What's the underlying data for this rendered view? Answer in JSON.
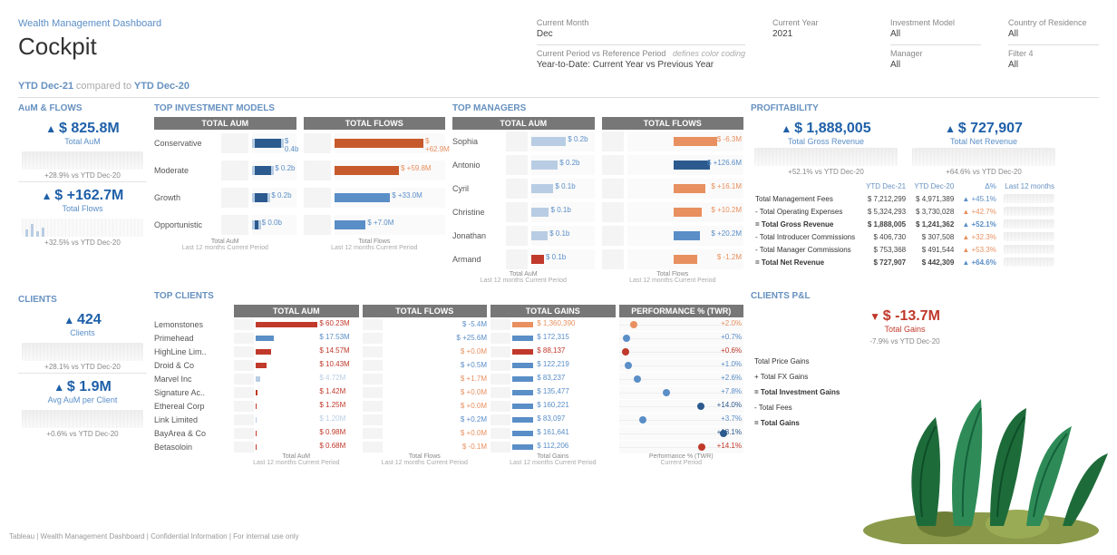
{
  "header": {
    "subtitle": "Wealth Management Dashboard",
    "title": "Cockpit"
  },
  "filters": {
    "current_month_label": "Current Month",
    "current_month": "Dec",
    "current_year_label": "Current Year",
    "current_year": "2021",
    "investment_model_label": "Investment Model",
    "investment_model": "All",
    "country_label": "Country of Residence",
    "country": "All",
    "period_vs_label": "Current Period vs Reference Period",
    "period_note": "defines color coding",
    "period_value": "Year-to-Date: Current Year vs Previous Year",
    "manager_label": "Manager",
    "manager": "All",
    "filter4_label": "Filter 4",
    "filter4": "All"
  },
  "period": {
    "current": "YTD Dec-21",
    "compare_word": "compared to",
    "reference": "YTD Dec-20"
  },
  "aum_flows": {
    "title": "AuM & FLOWS",
    "aum_value": "$ 825.8M",
    "aum_label": "Total AuM",
    "aum_delta": "+28.9% vs YTD Dec-20",
    "flows_value": "$ +162.7M",
    "flows_label": "Total Flows",
    "flows_delta": "+32.5% vs YTD Dec-20"
  },
  "top_models": {
    "title": "TOP INVESTMENT MODELS",
    "col_aum": "TOTAL AUM",
    "col_flows": "TOTAL FLOWS",
    "axis_aum": "Total AuM",
    "axis_flows": "Total Flows",
    "axis_sub1": "Last 12 months",
    "axis_sub2": "Current Period",
    "rows": [
      {
        "name": "Conservative",
        "aum_val": "$ 0.4b",
        "flow_val": "$ +62.9M",
        "flow_color": "dor",
        "aum_w": 60
      },
      {
        "name": "Moderate",
        "aum_val": "$ 0.2b",
        "flow_val": "$ +59.8M",
        "flow_color": "dor",
        "aum_w": 38
      },
      {
        "name": "Growth",
        "aum_val": "$ 0.2b",
        "flow_val": "$ +33.0M",
        "flow_color": "blue",
        "aum_w": 30
      },
      {
        "name": "Opportunistic",
        "aum_val": "$ 0.0b",
        "flow_val": "$ +7.0M",
        "flow_color": "blue",
        "aum_w": 8
      }
    ]
  },
  "top_managers": {
    "title": "TOP MANAGERS",
    "col_aum": "TOTAL AUM",
    "col_flows": "TOTAL FLOWS",
    "rows": [
      {
        "name": "Sophia",
        "aum_val": "$ 0.2b",
        "flow_val": "$ -6.3M",
        "flow_color": "or",
        "aum_w": 55
      },
      {
        "name": "Antonio",
        "aum_val": "$ 0.2b",
        "flow_val": "$ +126.6M",
        "flow_color": "dark",
        "aum_w": 42
      },
      {
        "name": "Cyril",
        "aum_val": "$ 0.1b",
        "flow_val": "$ +16.1M",
        "flow_color": "or",
        "aum_w": 35
      },
      {
        "name": "Christine",
        "aum_val": "$ 0.1b",
        "flow_val": "$ +10.2M",
        "flow_color": "or",
        "aum_w": 28
      },
      {
        "name": "Jonathan",
        "aum_val": "$ 0.1b",
        "flow_val": "$ +20.2M",
        "flow_color": "blue",
        "aum_w": 26
      },
      {
        "name": "Armand",
        "aum_val": "$ 0.1b",
        "flow_val": "$ -1.2M",
        "flow_color": "or",
        "aum_w": 20,
        "aum_color": "red"
      }
    ]
  },
  "profitability": {
    "title": "PROFITABILITY",
    "gross_value": "$ 1,888,005",
    "gross_label": "Total Gross Revenue",
    "gross_delta": "+52.1% vs YTD Dec-20",
    "net_value": "$ 727,907",
    "net_label": "Total Net Revenue",
    "net_delta": "+64.6% vs YTD Dec-20",
    "col_current": "YTD Dec-21",
    "col_ref": "YTD Dec-20",
    "col_delta": "Δ%",
    "col_spark": "Last 12 months",
    "rows": [
      {
        "label": "Total Management Fees",
        "cur": "$ 7,212,299",
        "ref": "$ 4,971,389",
        "delta": "+45.1%",
        "dcolor": "blue"
      },
      {
        "label": "- Total Operating Expenses",
        "cur": "$ 5,324,293",
        "ref": "$ 3,730,028",
        "delta": "+42.7%",
        "dcolor": "or"
      },
      {
        "label": "= Total Gross Revenue",
        "cur": "$ 1,888,005",
        "ref": "$ 1,241,362",
        "delta": "+52.1%",
        "dcolor": "blue",
        "total": true
      },
      {
        "label": "- Total Introducer Commissions",
        "cur": "$ 406,730",
        "ref": "$ 307,508",
        "delta": "+32.3%",
        "dcolor": "or"
      },
      {
        "label": "- Total Manager Commissions",
        "cur": "$ 753,368",
        "ref": "$ 491,544",
        "delta": "+53.3%",
        "dcolor": "or"
      },
      {
        "label": "= Total Net Revenue",
        "cur": "$ 727,907",
        "ref": "$ 442,309",
        "delta": "+64.6%",
        "dcolor": "blue",
        "total": true
      }
    ]
  },
  "clients": {
    "title": "CLIENTS",
    "count_value": "424",
    "count_label": "Clients",
    "count_delta": "+28.1% vs YTD Dec-20",
    "avg_value": "$ 1.9M",
    "avg_label": "Avg AuM per Client",
    "avg_delta": "+0.6% vs YTD Dec-20"
  },
  "top_clients": {
    "title": "TOP CLIENTS",
    "col_aum": "TOTAL AUM",
    "col_flows": "TOTAL FLOWS",
    "col_gains": "TOTAL GAINS",
    "col_perf": "PERFORMANCE % (TWR)",
    "axis_aum": "Total AuM",
    "axis_flows": "Total Flows",
    "axis_gains": "Total Gains",
    "axis_perf": "Performance % (TWR)",
    "axis_sub1": "Last 12 months",
    "axis_sub2": "Current Period",
    "rows": [
      {
        "name": "Lemonstones",
        "aum": "$ 60.23M",
        "aum_c": "red",
        "flow": "$ -5.4M",
        "flow_c": "blue",
        "gain": "$ 1,360,390",
        "gain_c": "or",
        "perf": "+2.0%",
        "perf_c": "or"
      },
      {
        "name": "Primehead",
        "aum": "$ 17.53M",
        "aum_c": "blue",
        "flow": "$ +25.6M",
        "flow_c": "blue",
        "gain": "$ 172,315",
        "gain_c": "blue",
        "perf": "+0.7%",
        "perf_c": "blue"
      },
      {
        "name": "HighLine Lim..",
        "aum": "$ 14.57M",
        "aum_c": "red",
        "flow": "$ +0.0M",
        "flow_c": "or",
        "gain": "$ 88,137",
        "gain_c": "red",
        "perf": "+0.6%",
        "perf_c": "red"
      },
      {
        "name": "Droid & Co",
        "aum": "$ 10.43M",
        "aum_c": "red",
        "flow": "$ +0.5M",
        "flow_c": "blue",
        "gain": "$ 122,219",
        "gain_c": "blue",
        "perf": "+1.0%",
        "perf_c": "blue"
      },
      {
        "name": "Marvel Inc",
        "aum": "$ 4.72M",
        "aum_c": "lt",
        "flow": "$ +1.7M",
        "flow_c": "or",
        "gain": "$ 83,237",
        "gain_c": "blue",
        "perf": "+2.6%",
        "perf_c": "blue"
      },
      {
        "name": "Signature Ac..",
        "aum": "$ 1.42M",
        "aum_c": "red",
        "flow": "$ +0.0M",
        "flow_c": "or",
        "gain": "$ 135,477",
        "gain_c": "blue",
        "perf": "+7.8%",
        "perf_c": "blue"
      },
      {
        "name": "Ethereal Corp",
        "aum": "$ 1.25M",
        "aum_c": "red",
        "flow": "$ +0.0M",
        "flow_c": "or",
        "gain": "$ 160,221",
        "gain_c": "blue",
        "perf": "+14.0%",
        "perf_c": "dk"
      },
      {
        "name": "Link Limited",
        "aum": "$ 1.20M",
        "aum_c": "lt",
        "flow": "$ +0.2M",
        "flow_c": "blue",
        "gain": "$ 83,097",
        "gain_c": "blue",
        "perf": "+3.7%",
        "perf_c": "blue"
      },
      {
        "name": "BayArea & Co",
        "aum": "$ 0.98M",
        "aum_c": "red",
        "flow": "$ +0.0M",
        "flow_c": "or",
        "gain": "$ 161,641",
        "gain_c": "blue",
        "perf": "+18.1%",
        "perf_c": "dk"
      },
      {
        "name": "Betasoloin",
        "aum": "$ 0.68M",
        "aum_c": "red",
        "flow": "$ -0.1M",
        "flow_c": "or",
        "gain": "$ 112,206",
        "gain_c": "blue",
        "perf": "+14.1%",
        "perf_c": "red"
      }
    ]
  },
  "clients_pnl": {
    "title": "CLIENTS P&L",
    "gain_value": "$ -13.7M",
    "gain_label": "Total Gains",
    "gain_delta": "-7.9% vs YTD Dec-20",
    "rows": [
      {
        "label": "Total Price Gains"
      },
      {
        "label": "+ Total FX Gains"
      },
      {
        "label": "= Total Investment Gains",
        "total": true
      },
      {
        "label": "- Total Fees"
      },
      {
        "label": "= Total Gains",
        "total": true
      }
    ]
  },
  "footer": "Tableau | Wealth Management Dashboard | Confidential Information | For internal use only",
  "chart_data": {
    "type": "bar",
    "note": "Dashboard with multiple embedded bar & KPI charts",
    "kpis": [
      {
        "name": "Total AuM",
        "value": 825800000,
        "unit": "USD",
        "delta_pct": 28.9
      },
      {
        "name": "Total Flows",
        "value": 162700000,
        "unit": "USD",
        "delta_pct": 32.5
      },
      {
        "name": "Total Gross Revenue",
        "value": 1888005,
        "unit": "USD",
        "delta_pct": 52.1
      },
      {
        "name": "Total Net Revenue",
        "value": 727907,
        "unit": "USD",
        "delta_pct": 64.6
      },
      {
        "name": "Clients",
        "value": 424,
        "delta_pct": 28.1
      },
      {
        "name": "Avg AuM per Client",
        "value": 1900000,
        "unit": "USD",
        "delta_pct": 0.6
      },
      {
        "name": "Total Gains",
        "value": -13700000,
        "unit": "USD"
      }
    ],
    "top_investment_models": {
      "categories": [
        "Conservative",
        "Moderate",
        "Growth",
        "Opportunistic"
      ],
      "series": [
        {
          "name": "Total AuM (b)",
          "values": [
            0.4,
            0.2,
            0.2,
            0.0
          ]
        },
        {
          "name": "Total Flows (M)",
          "values": [
            62.9,
            59.8,
            33.0,
            7.0
          ]
        }
      ]
    },
    "top_managers": {
      "categories": [
        "Sophia",
        "Antonio",
        "Cyril",
        "Christine",
        "Jonathan",
        "Armand"
      ],
      "series": [
        {
          "name": "Total AuM (b)",
          "values": [
            0.2,
            0.2,
            0.1,
            0.1,
            0.1,
            0.1
          ]
        },
        {
          "name": "Total Flows (M)",
          "values": [
            -6.3,
            126.6,
            16.1,
            10.2,
            20.2,
            -1.2
          ]
        }
      ]
    },
    "profitability_table": [
      {
        "metric": "Total Management Fees",
        "ytd_dec21": 7212299,
        "ytd_dec20": 4971389,
        "delta_pct": 45.1
      },
      {
        "metric": "Total Operating Expenses",
        "ytd_dec21": 5324293,
        "ytd_dec20": 3730028,
        "delta_pct": 42.7
      },
      {
        "metric": "Total Gross Revenue",
        "ytd_dec21": 1888005,
        "ytd_dec20": 1241362,
        "delta_pct": 52.1
      },
      {
        "metric": "Total Introducer Commissions",
        "ytd_dec21": 406730,
        "ytd_dec20": 307508,
        "delta_pct": 32.3
      },
      {
        "metric": "Total Manager Commissions",
        "ytd_dec21": 753368,
        "ytd_dec20": 491544,
        "delta_pct": 53.3
      },
      {
        "metric": "Total Net Revenue",
        "ytd_dec21": 727907,
        "ytd_dec20": 442309,
        "delta_pct": 64.6
      }
    ],
    "top_clients": {
      "categories": [
        "Lemonstones",
        "Primehead",
        "HighLine Lim..",
        "Droid & Co",
        "Marvel Inc",
        "Signature Ac..",
        "Ethereal Corp",
        "Link Limited",
        "BayArea & Co",
        "Betasoloin"
      ],
      "series": [
        {
          "name": "Total AuM (M)",
          "values": [
            60.23,
            17.53,
            14.57,
            10.43,
            4.72,
            1.42,
            1.25,
            1.2,
            0.98,
            0.68
          ]
        },
        {
          "name": "Total Flows (M)",
          "values": [
            -5.4,
            25.6,
            0.0,
            0.5,
            1.7,
            0.0,
            0.0,
            0.2,
            0.0,
            -0.1
          ]
        },
        {
          "name": "Total Gains ($)",
          "values": [
            1360390,
            172315,
            88137,
            122219,
            83237,
            135477,
            160221,
            83097,
            161641,
            112206
          ]
        },
        {
          "name": "Performance % (TWR)",
          "values": [
            2.0,
            0.7,
            0.6,
            1.0,
            2.6,
            7.8,
            14.0,
            3.7,
            18.1,
            14.1
          ]
        }
      ]
    }
  }
}
